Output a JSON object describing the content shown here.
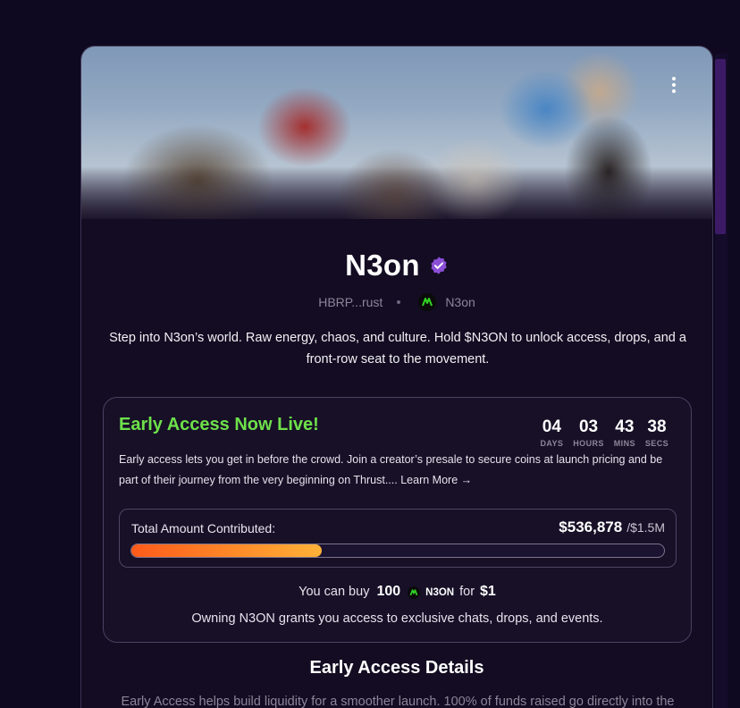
{
  "token": {
    "name": "N3on",
    "address_short": "HBRP...rust",
    "creator_name": "N3on",
    "description": "Step into N3on’s world. Raw energy, chaos, and culture. Hold $N3ON to unlock access, drops, and a front-row seat to the movement."
  },
  "early_access": {
    "title": "Early Access Now Live!",
    "countdown": [
      {
        "value": "04",
        "label": "DAYS"
      },
      {
        "value": "03",
        "label": "HOURS"
      },
      {
        "value": "43",
        "label": "MINS"
      },
      {
        "value": "38",
        "label": "SECS"
      }
    ],
    "text": "Early access lets you get in before the crowd. Join a creator’s presale to secure coins at launch pricing and be part of their journey from the very beginning on Thrust....",
    "learn_more": "Learn More →",
    "contribution": {
      "label": "Total Amount Contributed:",
      "raised": "$536,878",
      "goal": "/$1.5M",
      "progress_fraction": 0.358
    },
    "buy": {
      "prefix": "You can buy",
      "amount": "100",
      "ticker": "N3ON",
      "for_word": "for",
      "price": "$1"
    },
    "owning_text": "Owning N3ON grants you access to exclusive chats, drops, and events."
  },
  "details": {
    "heading": "Early Access Details",
    "text": "Early Access helps build liquidity for a smoother launch. 100% of funds raised go directly into the"
  },
  "colors": {
    "accent_green": "#6ee04a",
    "verified_purple": "#8a4fd6",
    "progress_start": "#ff5a1a",
    "progress_end": "#ffb238",
    "background": "#0e0820",
    "card": "#130c22"
  },
  "icons": {
    "verified": "verified-badge-icon",
    "menu": "more-vertical-icon",
    "token_logo": "n3on-logo-icon",
    "arrow": "arrow-right-icon"
  }
}
